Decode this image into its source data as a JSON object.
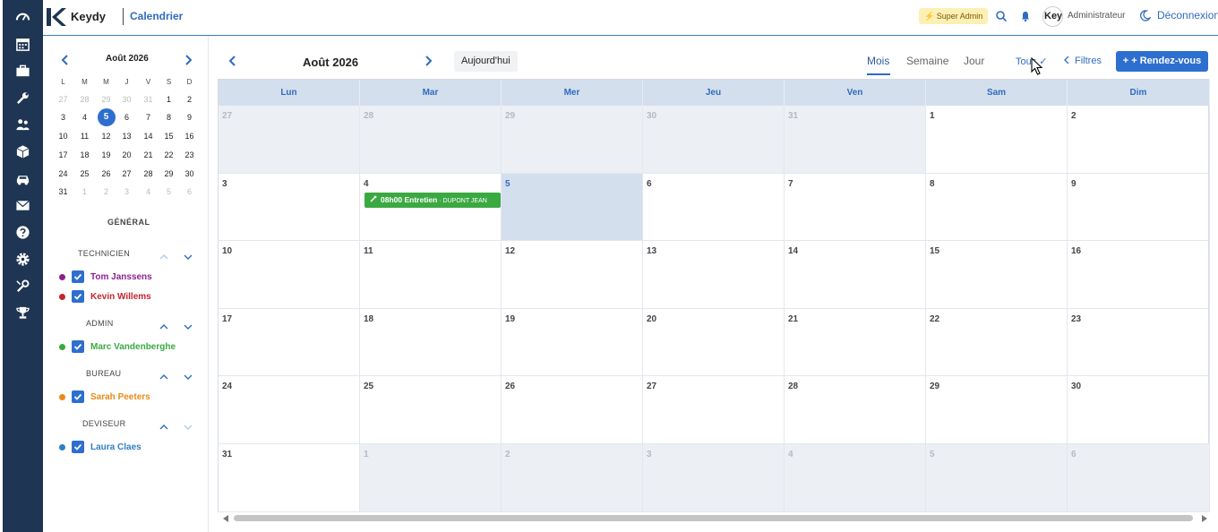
{
  "app": {
    "brand": "Keydy",
    "page_title": "Calendrier",
    "role_badge": "⚡ Super Admin",
    "avatar_text": "Keydy",
    "user_name": "Administrateur",
    "logout_label": "Déconnexion"
  },
  "rail": {
    "icons": [
      "dashboard-icon",
      "calendar-icon",
      "briefcase-icon",
      "wrench-icon",
      "users-icon",
      "box-icon",
      "car-icon",
      "mail-icon",
      "help-icon",
      "settings-icon",
      "tools-icon",
      "trophy-icon"
    ]
  },
  "mini_calendar": {
    "title": "Août 2026",
    "weekdays": [
      "L",
      "M",
      "M",
      "J",
      "V",
      "S",
      "D"
    ],
    "weeks": [
      [
        "27",
        "28",
        "29",
        "30",
        "31",
        "1",
        "2"
      ],
      [
        "3",
        "4",
        "5",
        "6",
        "7",
        "8",
        "9"
      ],
      [
        "10",
        "11",
        "12",
        "13",
        "14",
        "15",
        "16"
      ],
      [
        "17",
        "18",
        "19",
        "20",
        "21",
        "22",
        "23"
      ],
      [
        "24",
        "25",
        "26",
        "27",
        "28",
        "29",
        "30"
      ],
      [
        "31",
        "1",
        "2",
        "3",
        "4",
        "5",
        "6"
      ]
    ]
  },
  "sidebar": {
    "section_label": "GÉNÉRAL",
    "groups": [
      {
        "title": "TECHNICIEN",
        "members": [
          {
            "name": "Tom Janssens",
            "color": "#8b2291"
          },
          {
            "name": "Kevin Willems",
            "color": "#c4262e"
          }
        ]
      },
      {
        "title": "ADMIN",
        "members": [
          {
            "name": "Marc Vandenberghe",
            "color": "#3ba942"
          }
        ]
      },
      {
        "title": "BUREAU",
        "members": [
          {
            "name": "Sarah Peeters",
            "color": "#e88a1a"
          }
        ]
      },
      {
        "title": "DEVISEUR",
        "members": [
          {
            "name": "Laura Claes",
            "color": "#2f7fc4"
          }
        ]
      }
    ]
  },
  "toolbar": {
    "month_title": "Août 2026",
    "today_label": "Aujourd'hui",
    "views": [
      "Mois",
      "Semaine",
      "Jour"
    ],
    "active_view": "Mois",
    "tous_label": "Tous ✓",
    "filters_label": "Filtres",
    "add_label": "+ + Rendez-vous"
  },
  "calendar": {
    "weekdays": [
      "Lun",
      "Mar",
      "Mer",
      "Jeu",
      "Ven",
      "Sam",
      "Dim"
    ],
    "weeks": [
      [
        "27",
        "28",
        "29",
        "30",
        "31",
        "1",
        "2"
      ],
      [
        "3",
        "4",
        "5",
        "6",
        "7",
        "8",
        "9"
      ],
      [
        "10",
        "11",
        "12",
        "13",
        "14",
        "15",
        "16"
      ],
      [
        "17",
        "18",
        "19",
        "20",
        "21",
        "22",
        "23"
      ],
      [
        "24",
        "25",
        "26",
        "27",
        "28",
        "29",
        "30"
      ],
      [
        "31",
        "1",
        "2",
        "3",
        "4",
        "5",
        "6"
      ]
    ],
    "event": {
      "time_title": "08h00 Entretien",
      "client": " · DUPONT JEAN",
      "color": "#3ba942"
    }
  }
}
